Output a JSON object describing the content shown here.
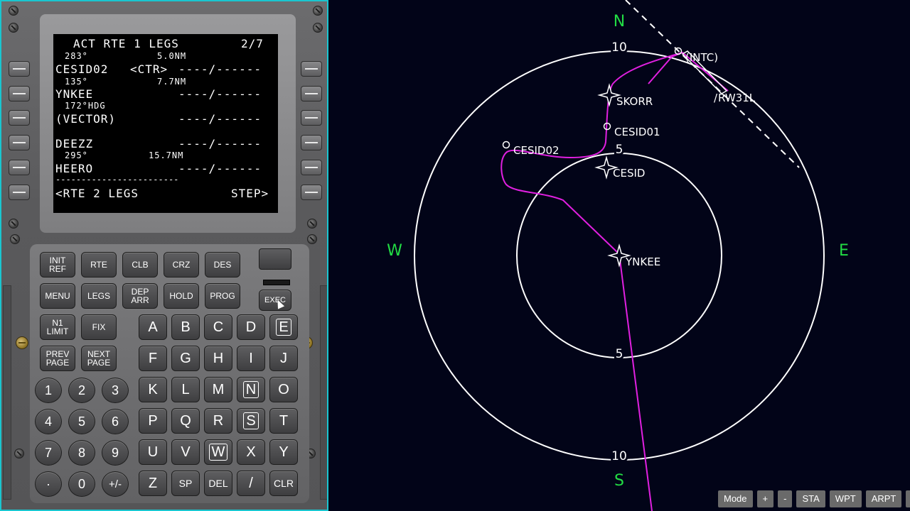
{
  "cdu": {
    "lines": {
      "title": "ACT RTE 1 LEGS",
      "page": "2/7",
      "l1_small_left": "283°",
      "l1_small_right": "5.0NM",
      "l1_big_left": "CESID02",
      "l1_big_mid": "<CTR>",
      "l1_big_right": "----/------",
      "l2_small_left": "135°",
      "l2_small_right": "7.7NM",
      "l2_big_left": "YNKEE",
      "l2_big_right": "----/------",
      "l3_small_left": "172°HDG",
      "l3_big_left": "(VECTOR)",
      "l3_big_right": "----/------",
      "l4_big_left": "DEEZZ",
      "l4_big_right": "----/------",
      "l5_small_left": "295°",
      "l5_small_right": "15.7NM",
      "l5_big_left": "HEERO",
      "l5_big_right": "----/------",
      "dashes": "------------------------",
      "l6_left": "<RTE 2 LEGS",
      "l6_right": "STEP>"
    },
    "function_keys": {
      "init_ref": "INIT REF",
      "rte": "RTE",
      "clb": "CLB",
      "crz": "CRZ",
      "des": "DES",
      "menu": "MENU",
      "legs": "LEGS",
      "dep_arr": "DEP ARR",
      "hold": "HOLD",
      "prog": "PROG",
      "exec": "EXEC",
      "n1_limit": "N1 LIMIT",
      "fix": "FIX",
      "prev_page": "PREV PAGE",
      "next_page": "NEXT PAGE"
    },
    "alpha_keys": [
      "A",
      "B",
      "C",
      "D",
      "E",
      "F",
      "G",
      "H",
      "I",
      "J",
      "K",
      "L",
      "M",
      "N",
      "O",
      "P",
      "Q",
      "R",
      "S",
      "T",
      "U",
      "V",
      "W",
      "X",
      "Y",
      "Z",
      "SP",
      "DEL",
      "/",
      "CLR"
    ],
    "num_keys": [
      "1",
      "2",
      "3",
      "4",
      "5",
      "6",
      "7",
      "8",
      "9",
      "·",
      "0",
      "+/-"
    ]
  },
  "nav": {
    "compass": {
      "n": "N",
      "s": "S",
      "e": "E",
      "w": "W"
    },
    "ring_labels": {
      "outer_top": "10",
      "outer_bottom": "10",
      "inner_top": "5",
      "inner_bottom": "5"
    },
    "waypoints": {
      "intc": "(INTC)",
      "rw": "RW31L",
      "skorr": "SKORR",
      "cesid01": "CESID01",
      "cesid02": "CESID02",
      "cesid": "CESID",
      "ynkee": "YNKEE"
    },
    "colors": {
      "route": "#e020e0",
      "compass": "#22dd44",
      "rings": "#ffffff"
    }
  },
  "toolbar": {
    "mode": "Mode",
    "plus": "+",
    "minus": "-",
    "sta": "STA",
    "wpt": "WPT",
    "arpt": "ARPT",
    "extra": "|"
  }
}
